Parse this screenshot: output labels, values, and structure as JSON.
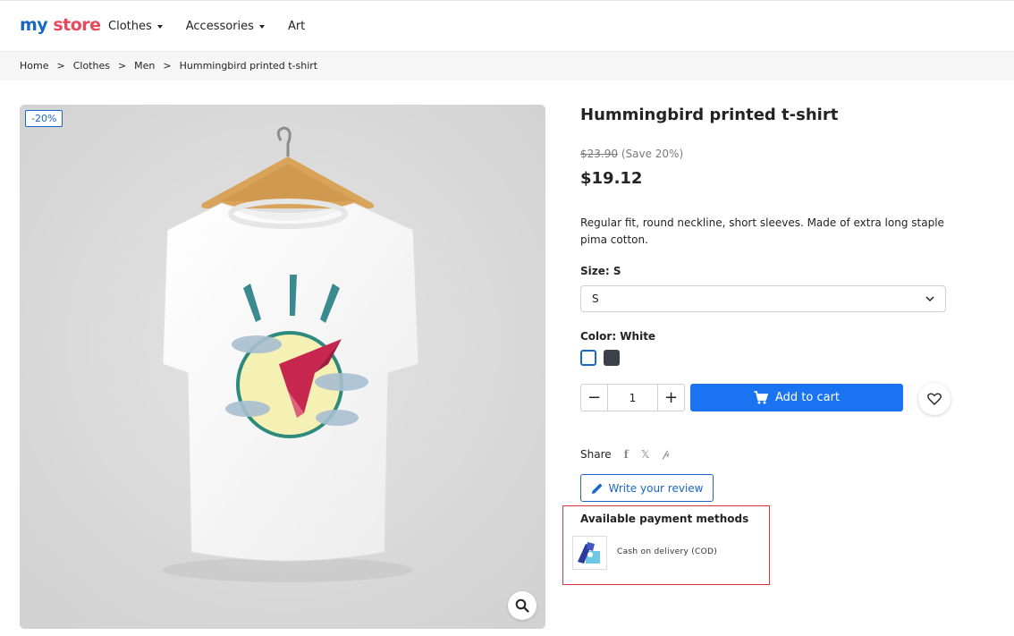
{
  "header": {
    "logo_my": "my",
    "logo_store": "store",
    "nav": [
      {
        "label": "Clothes",
        "has_dropdown": true
      },
      {
        "label": "Accessories",
        "has_dropdown": true
      },
      {
        "label": "Art",
        "has_dropdown": false
      }
    ]
  },
  "breadcrumb": [
    "Home",
    "Clothes",
    "Men",
    "Hummingbird printed t-shirt"
  ],
  "breadcrumb_sep": ">",
  "product": {
    "discount_badge": "-20%",
    "title": "Hummingbird printed t-shirt",
    "old_price": "$23.90",
    "save_text": "(Save 20%)",
    "price": "$19.12",
    "description": "Regular fit, round neckline, short sleeves. Made of extra long staple pima cotton.",
    "size_label": "Size: S",
    "size_value": "S",
    "color_label": "Color: White",
    "colors": [
      {
        "name": "White",
        "hex": "#ffffff",
        "selected": true
      },
      {
        "name": "Dark grey",
        "hex": "#3c424a",
        "selected": false
      }
    ],
    "quantity": "1",
    "qty_minus": "−",
    "qty_plus": "+",
    "add_to_cart": "Add to cart",
    "share_label": "Share",
    "review_button": "Write your review"
  },
  "payment": {
    "title": "Available payment methods",
    "methods": [
      {
        "label": "Cash on delivery (COD)",
        "icon": "cod-icon"
      }
    ]
  },
  "colors": {
    "primary": "#1a74f2",
    "brand_blue": "#1a66c5",
    "brand_red": "#e64a5b",
    "highlight_border": "#d9373c"
  }
}
